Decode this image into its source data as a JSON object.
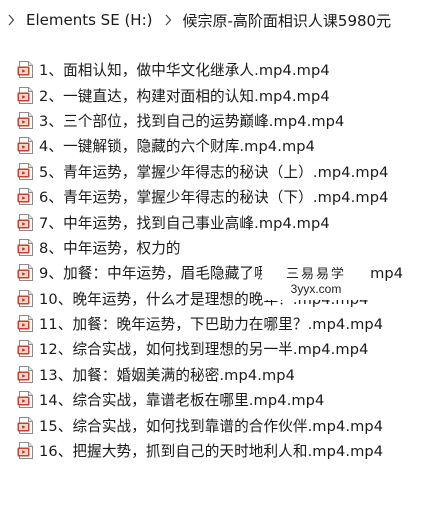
{
  "breadcrumb": {
    "drive": "Elements SE (H:)",
    "folder": "候宗原-高阶面相识人课5980元"
  },
  "files": [
    {
      "name": "1、面相认知，做中华文化继承人.mp4.mp4"
    },
    {
      "name": "2、一键直达，构建对面相的认知.mp4.mp4"
    },
    {
      "name": "3、三个部位，找到自己的运势巅峰.mp4.mp4"
    },
    {
      "name": "4、一键解锁，隐藏的六个财库.mp4.mp4"
    },
    {
      "name": "5、青年运势，掌握少年得志的秘诀（上）.mp4.mp4"
    },
    {
      "name": "6、青年运势，掌握少年得志的秘诀（下）.mp4.mp4"
    },
    {
      "name": "7、中年运势，找到自己事业高峰.mp4.mp4"
    },
    {
      "name": "8、中年运势，权力的"
    },
    {
      "name": "9、加餐：中年运势，眉毛隐藏了哪些秘密？.mp4.mp4"
    },
    {
      "name": "10、晚年运势，什么才是理想的晚年？.mp4.mp4"
    },
    {
      "name": "11、加餐：晚年运势，下巴助力在哪里？.mp4.mp4"
    },
    {
      "name": "12、综合实战，如何找到理想的另一半.mp4.mp4"
    },
    {
      "name": "13、加餐：婚姻美满的秘密.mp4.mp4"
    },
    {
      "name": "14、综合实战，靠谱老板在哪里.mp4.mp4"
    },
    {
      "name": "15、综合实战，如何找到靠谱的合作伙伴.mp4.mp4"
    },
    {
      "name": "16、把握大势，抓到自己的天时地利人和.mp4.mp4"
    }
  ],
  "watermark": {
    "title": "三易易学",
    "url": "3yyx.com"
  },
  "icons": {
    "separator": "chevron-right-icon",
    "file": "video-file-icon"
  }
}
